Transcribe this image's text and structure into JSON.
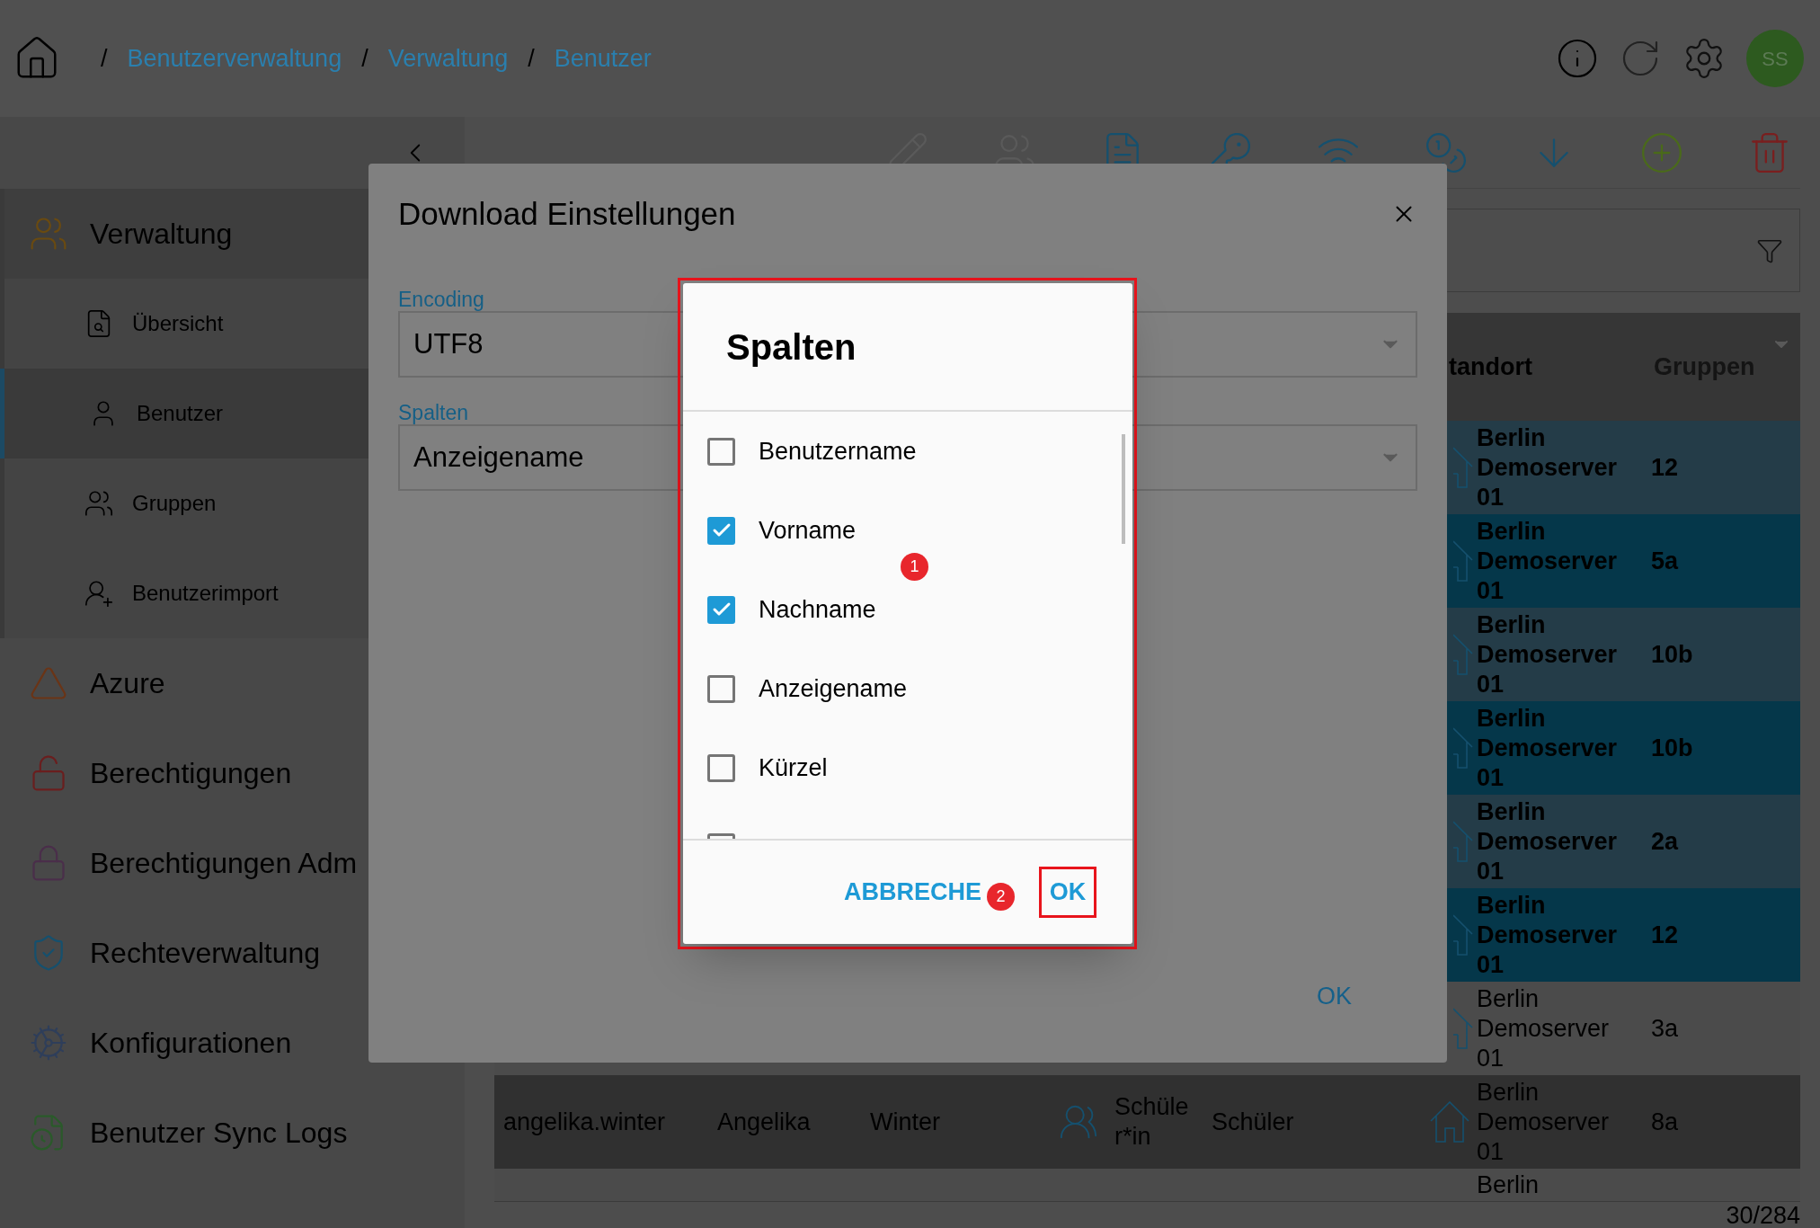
{
  "breadcrumbs": [
    {
      "separator": "/",
      "label": "Benutzerverwaltung"
    },
    {
      "separator": "/",
      "label": "Verwaltung"
    },
    {
      "separator": "/",
      "label": "Benutzer"
    }
  ],
  "avatar": {
    "initials": "SS"
  },
  "sidebar": {
    "items": [
      {
        "label": "Verwaltung",
        "expanded": true,
        "children": [
          {
            "label": "Übersicht",
            "selected": false
          },
          {
            "label": "Benutzer",
            "selected": true
          },
          {
            "label": "Gruppen",
            "selected": false
          },
          {
            "label": "Benutzerimport",
            "selected": false
          }
        ]
      },
      {
        "label": "Azure",
        "expanded": false
      },
      {
        "label": "Berechtigungen",
        "expanded": false
      },
      {
        "label": "Berechtigungen Adm",
        "expanded": false
      },
      {
        "label": "Rechteverwaltung",
        "expanded": false
      },
      {
        "label": "Konfigurationen",
        "expanded": false
      },
      {
        "label": "Benutzer Sync Logs",
        "expanded": false
      }
    ]
  },
  "table": {
    "columns": {
      "standort": "tandort",
      "gruppen": "Gruppen"
    },
    "rows": [
      {
        "selected": true,
        "standort": "Berlin Demoserver 01",
        "gruppen": "12"
      },
      {
        "selected": true,
        "standort": "Berlin Demoserver 01",
        "gruppen": "5a"
      },
      {
        "selected": true,
        "standort": "Berlin Demoserver 01",
        "gruppen": "10b"
      },
      {
        "selected": true,
        "standort": "Berlin Demoserver 01",
        "gruppen": "10b"
      },
      {
        "selected": true,
        "standort": "Berlin Demoserver 01",
        "gruppen": "2a"
      },
      {
        "selected": true,
        "standort": "Berlin Demoserver 01",
        "gruppen": "12"
      },
      {
        "selected": false,
        "standort": "Berlin Demoserver 01",
        "gruppen": "3a"
      },
      {
        "selected": false,
        "benutzername": "angelika.winter",
        "vorname": "Angelika",
        "nachname": "Winter",
        "rolle": "Schüler*in",
        "gruppe": "Schüler",
        "standort": "Berlin Demoserver 01",
        "gruppen": "8a"
      },
      {
        "selected": false,
        "standort": "Berlin"
      }
    ]
  },
  "status_bar": {
    "count": "30/284"
  },
  "download_dialog": {
    "title": "Download Einstellungen",
    "fields": [
      {
        "label": "Encoding",
        "value": "UTF8"
      },
      {
        "label": "Spalten",
        "value": "Anzeigename"
      }
    ],
    "ok": "OK"
  },
  "columns_dialog": {
    "title": "Spalten",
    "items": [
      {
        "label": "Benutzername",
        "checked": false
      },
      {
        "label": "Vorname",
        "checked": true
      },
      {
        "label": "Nachname",
        "checked": true
      },
      {
        "label": "Anzeigename",
        "checked": false
      },
      {
        "label": "Kürzel",
        "checked": false
      },
      {
        "checked": false
      }
    ],
    "cancel": "ABBRECHE",
    "ok": "OK",
    "markers": [
      "1",
      "2"
    ]
  }
}
